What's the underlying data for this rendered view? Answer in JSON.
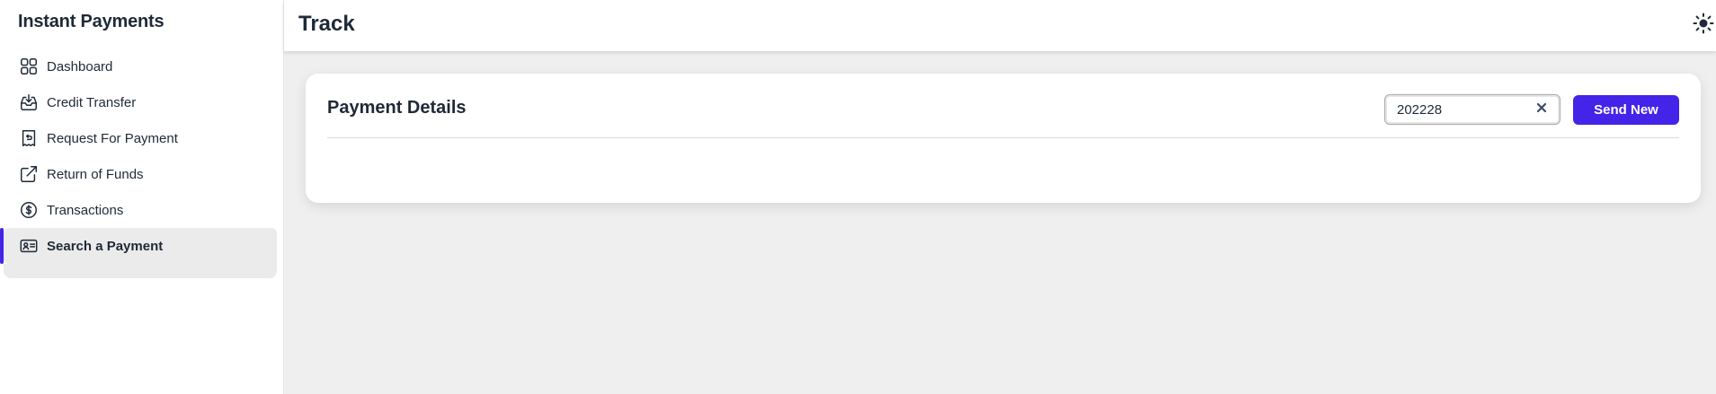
{
  "app": {
    "title": "Instant Payments"
  },
  "header": {
    "title": "Track"
  },
  "sidebar": {
    "items": [
      {
        "label": "Dashboard",
        "icon": "dashboard-grid-icon"
      },
      {
        "label": "Credit Transfer",
        "icon": "inbox-download-icon"
      },
      {
        "label": "Request For Payment",
        "icon": "receipt-return-icon"
      },
      {
        "label": "Return of Funds",
        "icon": "external-link-icon"
      },
      {
        "label": "Transactions",
        "icon": "dollar-circle-icon"
      },
      {
        "label": "Search a Payment",
        "icon": "id-card-icon",
        "active": true
      }
    ]
  },
  "card": {
    "title": "Payment Details",
    "search_value": "202228",
    "send_label": "Send New"
  },
  "colors": {
    "accent": "#4324e8",
    "background": "#efefef",
    "active_item_bg": "#ebebeb"
  }
}
